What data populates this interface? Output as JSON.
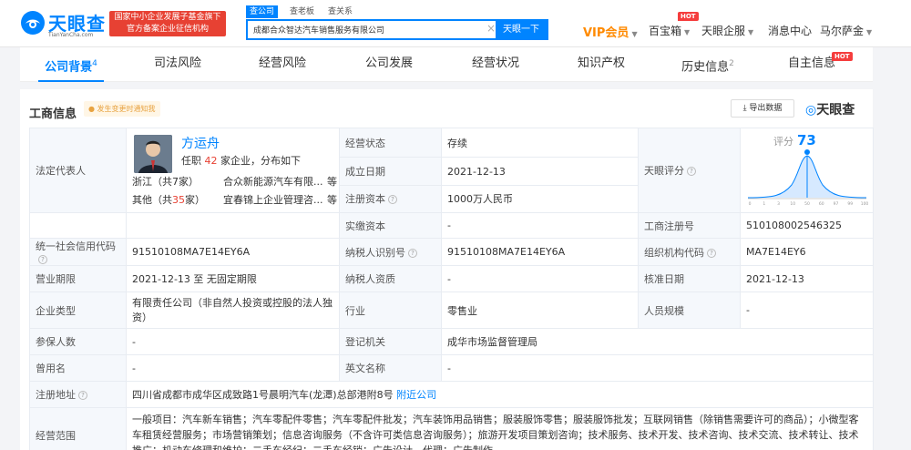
{
  "header": {
    "logo_text": "天眼查",
    "logo_sub": "TianYanCha.com",
    "badge_line1": "国家中小企业发展子基金旗下",
    "badge_line2": "官方备案企业征信机构",
    "search_tabs": [
      "查公司",
      "查老板",
      "查关系"
    ],
    "search_value": "成都合众智达汽车销售服务有限公司",
    "search_clear": "×",
    "search_button": "天眼一下",
    "vip": "VIP会员",
    "nav": [
      "百宝箱",
      "天眼企服",
      "消息中心",
      "马尔萨金"
    ],
    "hot": "HOT"
  },
  "tabs": [
    {
      "label": "公司背景",
      "count": "4"
    },
    {
      "label": "司法风险",
      "count": ""
    },
    {
      "label": "经营风险",
      "count": ""
    },
    {
      "label": "公司发展",
      "count": ""
    },
    {
      "label": "经营状况",
      "count": ""
    },
    {
      "label": "知识产权",
      "count": ""
    },
    {
      "label": "历史信息",
      "count": "2"
    },
    {
      "label": "自主信息",
      "count": ""
    }
  ],
  "section": {
    "title": "工商信息",
    "notify": "发生变更时通知我",
    "export": "导出数据",
    "brand": "天眼查"
  },
  "legal_rep": {
    "label": "法定代表人",
    "name": "方运舟",
    "sub_pre": "任职",
    "sub_count": "42",
    "sub_post": "家企业，分布如下",
    "line1_region": "浙江（共7家）",
    "line1_company": "合众新能源汽车有限...",
    "line1_more": "等",
    "line2_region_pre": "其他（共",
    "line2_region_count": "35",
    "line2_region_post": "家）",
    "line2_company": "宜春锦上企业管理咨...",
    "line2_more": "等"
  },
  "fields": {
    "status_label": "经营状态",
    "status_value": "存续",
    "found_label": "成立日期",
    "found_value": "2021-12-13",
    "reg_cap_label": "注册资本",
    "reg_cap_value": "1000万人民币",
    "paid_cap_label": "实缴资本",
    "paid_cap_value": "-",
    "score_label": "天眼评分",
    "score_text": "评分",
    "score_value": "73",
    "reg_no_label": "工商注册号",
    "reg_no_value": "510108002546325",
    "credit_label": "统一社会信用代码",
    "credit_value": "91510108MA7E14EY6A",
    "taxid_label": "纳税人识别号",
    "taxid_value": "91510108MA7E14EY6A",
    "org_label": "组织机构代码",
    "org_value": "MA7E14EY6",
    "term_label": "营业期限",
    "term_value": "2021-12-13 至 无固定期限",
    "taxq_label": "纳税人资质",
    "taxq_value": "-",
    "approve_label": "核准日期",
    "approve_value": "2021-12-13",
    "type_label": "企业类型",
    "type_value": "有限责任公司（非自然人投资或控股的法人独资）",
    "industry_label": "行业",
    "industry_value": "零售业",
    "staff_label": "人员规模",
    "staff_value": "-",
    "insured_label": "参保人数",
    "insured_value": "-",
    "authority_label": "登记机关",
    "authority_value": "成华市场监督管理局",
    "former_label": "曾用名",
    "former_value": "-",
    "en_label": "英文名称",
    "en_value": "-",
    "addr_label": "注册地址",
    "addr_value": "四川省成都市成华区成致路1号晨明汽车(龙潭)总部港附8号",
    "addr_link": "附近公司",
    "scope_label": "经营范围",
    "scope_value": "一般项目：汽车新车销售；汽车零配件零售；汽车零配件批发；汽车装饰用品销售；服装服饰零售；服装服饰批发；互联网销售（除销售需要许可的商品）；小微型客车租赁经营服务；市场营销策划；信息咨询服务（不含许可类信息咨询服务）；旅游开发项目策划咨询；技术服务、技术开发、技术咨询、技术交流、技术转让、技术推广；机动车修理和维护；二手车经纪；二手车经销；广告设计、代理；广告制作"
  },
  "score_chart": {
    "ticks": [
      "0",
      "1",
      "3",
      "10",
      "50",
      "60",
      "97",
      "99",
      "100"
    ]
  },
  "colors": {
    "accent": "#0084ff",
    "hot": "#f53d3d",
    "badge": "#e74133",
    "vip": "#ff8a00"
  }
}
